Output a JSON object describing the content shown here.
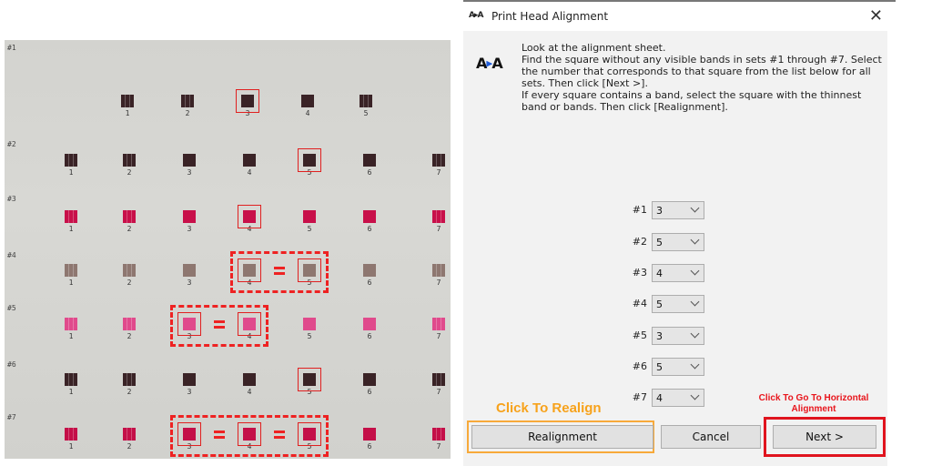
{
  "sheet": {
    "sets": [
      {
        "label": "#1",
        "numbers": [
          "1",
          "2",
          "3",
          "4",
          "5"
        ],
        "color": "#3a2326",
        "selected": [
          "3"
        ],
        "group": []
      },
      {
        "label": "#2",
        "numbers": [
          "1",
          "2",
          "3",
          "4",
          "5",
          "6",
          "7"
        ],
        "color": "#3a2326",
        "selected": [
          "5"
        ],
        "group": []
      },
      {
        "label": "#3",
        "numbers": [
          "1",
          "2",
          "3",
          "4",
          "5",
          "6",
          "7"
        ],
        "color": "#c8104a",
        "selected": [
          "4"
        ],
        "group": []
      },
      {
        "label": "#4",
        "numbers": [
          "1",
          "2",
          "3",
          "4",
          "5",
          "6",
          "7"
        ],
        "color": "#8e7770",
        "selected": [
          "4",
          "5"
        ],
        "group": [
          "4",
          "5"
        ]
      },
      {
        "label": "#5",
        "numbers": [
          "1",
          "2",
          "3",
          "4",
          "5",
          "6",
          "7"
        ],
        "color": "#e04a8c",
        "selected": [
          "3",
          "4"
        ],
        "group": [
          "3",
          "4"
        ]
      },
      {
        "label": "#6",
        "numbers": [
          "1",
          "2",
          "3",
          "4",
          "5",
          "6",
          "7"
        ],
        "color": "#3a2326",
        "selected": [
          "5"
        ],
        "group": []
      },
      {
        "label": "#7",
        "numbers": [
          "1",
          "2",
          "3",
          "4",
          "5",
          "6",
          "7"
        ],
        "color": "#c40f48",
        "selected": [
          "3",
          "4",
          "5"
        ],
        "group": [
          "3",
          "4",
          "5"
        ]
      }
    ]
  },
  "dialog": {
    "title": "Print Head Alignment",
    "title_icon": "A▸A",
    "close_icon": "✕",
    "instructions": [
      "Look at the alignment sheet.",
      "Find the square without any visible bands in sets #1 through #7. Select",
      "the number that corresponds to that square from the list below for all",
      "sets. Then click [Next >].",
      "If every square contains a band, select the square with the thinnest",
      "band or bands. Then click [Realignment]."
    ],
    "selections": [
      {
        "label": "#1",
        "value": "3"
      },
      {
        "label": "#2",
        "value": "5"
      },
      {
        "label": "#3",
        "value": "4"
      },
      {
        "label": "#4",
        "value": "5"
      },
      {
        "label": "#5",
        "value": "3"
      },
      {
        "label": "#6",
        "value": "5"
      },
      {
        "label": "#7",
        "value": "4"
      }
    ],
    "buttons": {
      "realignment": "Realignment",
      "cancel": "Cancel",
      "next": "Next >"
    }
  },
  "annotations": {
    "realign": "Click To Realign",
    "next_line1": "Click To Go To Horizontal",
    "next_line2": "Alignment",
    "orange": "#f7a93a",
    "red": "#e0141e"
  }
}
